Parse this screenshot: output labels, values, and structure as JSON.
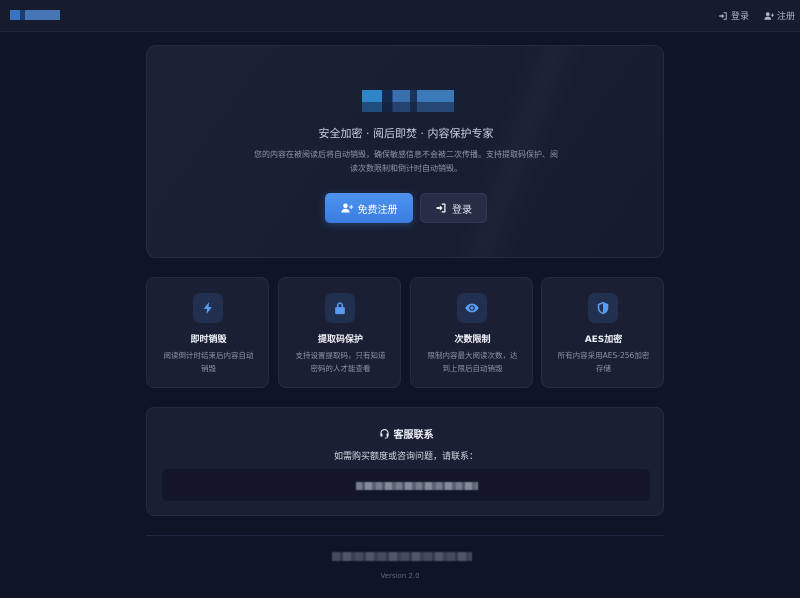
{
  "topbar": {
    "login_label": "登录",
    "register_label": "注册"
  },
  "hero": {
    "subtitle": "安全加密 · 阅后即焚 · 内容保护专家",
    "description": "您的内容在被阅读后将自动销毁，确保敏感信息不会被二次传播。支持提取码保护、阅读次数限制和倒计时自动销毁。",
    "register_button": "免费注册",
    "login_button": "登录"
  },
  "features": [
    {
      "icon": "bolt-icon",
      "title": "即时销毁",
      "desc": "阅读倒计时结束后内容自动销毁"
    },
    {
      "icon": "lock-icon",
      "title": "提取码保护",
      "desc": "支持设置提取码，只有知道密码的人才能查看"
    },
    {
      "icon": "eye-icon",
      "title": "次数限制",
      "desc": "限制内容最大阅读次数，达到上限后自动销毁"
    },
    {
      "icon": "shield-icon",
      "title": "AES加密",
      "desc": "所有内容采用AES-256加密存储"
    }
  ],
  "contact": {
    "title": "客服联系",
    "subtitle": "如需购买额度或咨询问题，请联系："
  },
  "footer": {
    "version": "Version 2.0"
  },
  "colors": {
    "background": "#0f1427",
    "accent": "#4e93ef",
    "card": "#1a1f33"
  }
}
